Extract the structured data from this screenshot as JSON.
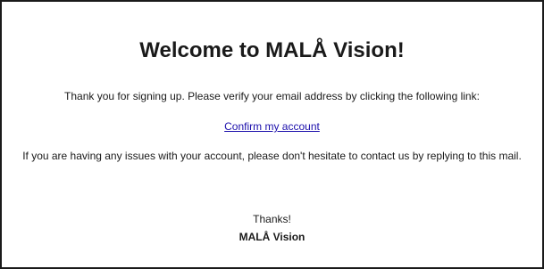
{
  "email": {
    "title": "Welcome to MALÅ Vision!",
    "intro": "Thank you for signing up. Please verify your email address by clicking the following link:",
    "confirm_link": "Confirm my account",
    "issues": "If you are having any issues with your account, please don't hesitate to contact us by replying to this mail.",
    "thanks": "Thanks!",
    "signature": "MALÅ Vision",
    "link_color": "#1a0dab"
  }
}
